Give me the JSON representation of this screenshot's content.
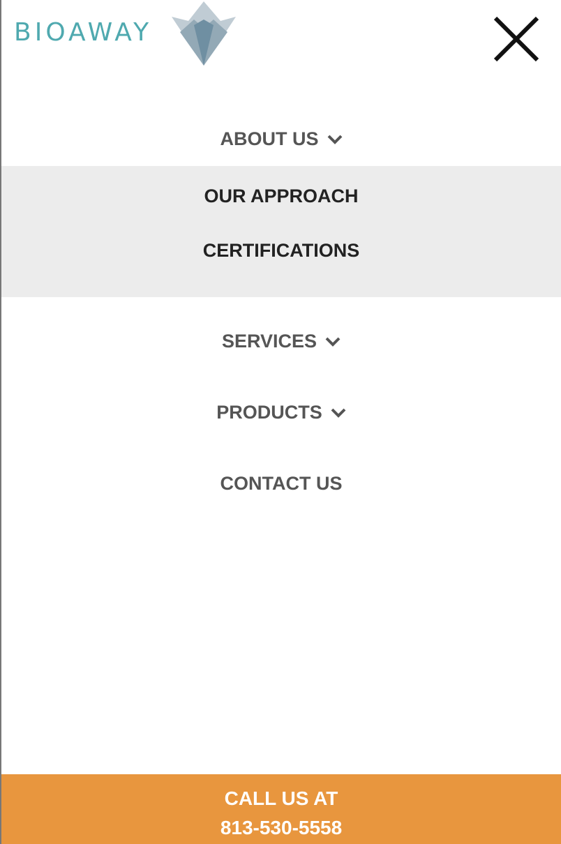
{
  "logo": {
    "text": "BIOAWAY"
  },
  "nav": {
    "about": "ABOUT US",
    "services": "SERVICES",
    "products": "PRODUCTS",
    "contact": "CONTACT US"
  },
  "submenu": [
    "OUR APPROACH",
    "CERTIFICATIONS"
  ],
  "cta": {
    "line1": "CALL US AT",
    "phone": "813-530-5558"
  },
  "colors": {
    "brand": "#4fa9af",
    "cta": "#e8963e",
    "submenu_bg": "#ececec"
  }
}
